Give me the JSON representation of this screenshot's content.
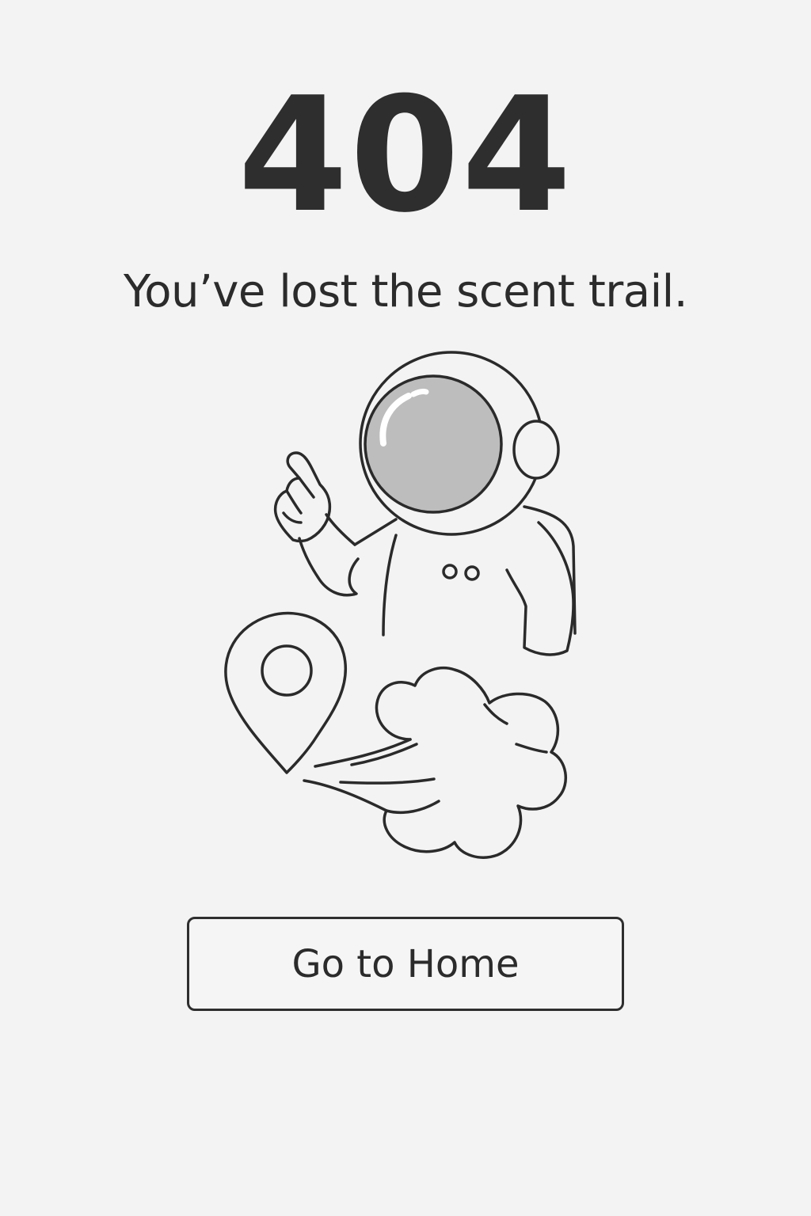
{
  "error": {
    "code": "404",
    "message": "You’ve lost the scent trail."
  },
  "illustration": {
    "subject": "astronaut-pointing-icon",
    "elements": [
      "astronaut-icon",
      "location-pin-icon",
      "dust-cloud-icon"
    ]
  },
  "actions": {
    "home_label": "Go to Home"
  },
  "colors": {
    "background": "#f3f3f3",
    "text": "#2b2b2b",
    "stroke": "#2a2a2a",
    "visor": "#bdbdbd"
  }
}
